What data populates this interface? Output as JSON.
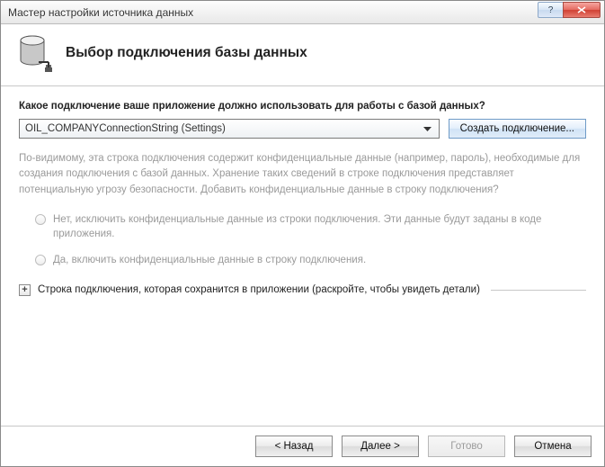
{
  "window": {
    "title": "Мастер настройки источника данных"
  },
  "header": {
    "title": "Выбор подключения базы данных"
  },
  "content": {
    "question": "Какое подключение ваше приложение должно использовать для работы с базой данных?",
    "selected_connection": "OIL_COMPANYConnectionString (Settings)",
    "new_connection_btn": "Создать подключение...",
    "warning_text": "По-видимому, эта строка подключения содержит конфиденциальные данные (например, пароль), необходимые для создания подключения с базой данных. Хранение таких сведений в строке подключения представляет потенциальную угрозу безопасности. Добавить конфиденциальные данные в строку подключения?",
    "radio_no": "Нет, исключить конфиденциальные данные из строки подключения. Эти данные будут заданы в коде приложения.",
    "radio_yes": "Да, включить конфиденциальные данные в строку подключения.",
    "expander_label": "Строка подключения, которая сохранится в приложении (раскройте, чтобы увидеть детали)",
    "expander_symbol": "+"
  },
  "footer": {
    "back": "< Назад",
    "next": "Далее >",
    "finish": "Готово",
    "cancel": "Отмена"
  }
}
